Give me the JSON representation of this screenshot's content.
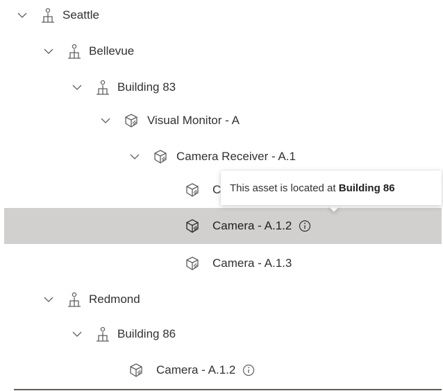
{
  "tree": {
    "nodes": [
      {
        "label": "Seattle",
        "type": "location",
        "expanded": true
      },
      {
        "label": "Bellevue",
        "type": "location",
        "expanded": true
      },
      {
        "label": "Building 83",
        "type": "location",
        "expanded": true
      },
      {
        "label": "Visual Monitor - A",
        "type": "asset",
        "expanded": true
      },
      {
        "label": "Camera Receiver - A.1",
        "type": "asset",
        "expanded": true
      },
      {
        "label": "Camera - A.1.1",
        "type": "asset",
        "visible_label": "C"
      },
      {
        "label": "Camera - A.1.2",
        "type": "asset",
        "selected": true,
        "info": true
      },
      {
        "label": "Camera - A.1.3",
        "type": "asset"
      },
      {
        "label": "Redmond",
        "type": "location",
        "expanded": true
      },
      {
        "label": "Building 86",
        "type": "location",
        "expanded": true
      },
      {
        "label": "Camera - A.1.2",
        "type": "asset",
        "info": true
      }
    ]
  },
  "tooltip": {
    "prefix": "This asset is located at",
    "location": "Building 86"
  },
  "icons": {
    "chevron": "chevron-down-icon",
    "location": "location-person-icon",
    "asset": "cube-asset-icon",
    "info": "info-icon"
  },
  "colors": {
    "selected_background": "#d2d0ce",
    "text": "#323130"
  }
}
